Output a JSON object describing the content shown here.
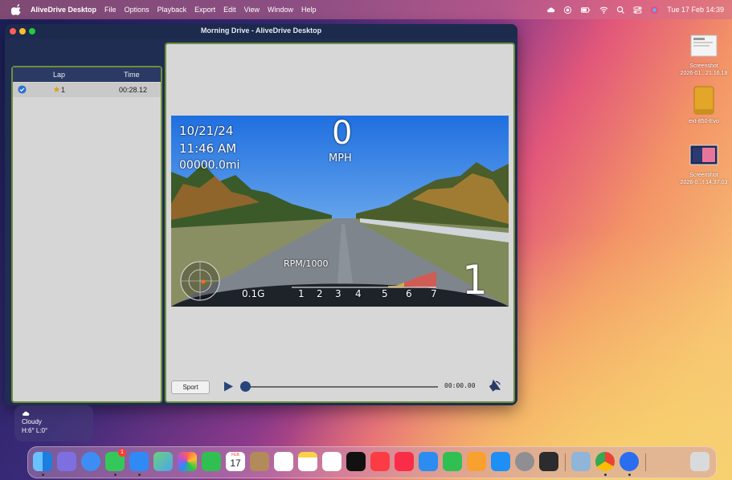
{
  "menubar": {
    "app_name": "AliveDrive Desktop",
    "menus": [
      "File",
      "Options",
      "Playback",
      "Export",
      "Edit",
      "View",
      "Window",
      "Help"
    ],
    "clock": "Tue 17 Feb  14:39"
  },
  "window": {
    "title": "Morning Drive - AliveDrive Desktop"
  },
  "laps_table": {
    "headers": {
      "lap": "Lap",
      "time": "Time"
    },
    "rows": [
      {
        "lap": "1",
        "time": "00:28.12",
        "starred": true,
        "selected": true
      }
    ]
  },
  "video_overlay": {
    "date": "10/21/24",
    "time": "11:46 AM",
    "odometer": "00000.0mi",
    "speed": "0",
    "speed_unit": "MPH",
    "gforce": "0.1G",
    "rpm_label": "RPM/1000",
    "rpm_ticks": [
      "1",
      "2",
      "3",
      "4",
      "5",
      "6",
      "7"
    ],
    "gear": "1"
  },
  "controls": {
    "mode_button": "Sport",
    "timecode": "00:00.00",
    "progress": 0
  },
  "weather": {
    "condition": "Cloudy",
    "high_low": "H:6° L:0°"
  },
  "desktop_icons": [
    {
      "label1": "Screenshot",
      "label2": "2026-01...21.16.18"
    },
    {
      "label1": "ext-850-Evo",
      "label2": ""
    },
    {
      "label1": "Screenshot",
      "label2": "2026-0...t 14.37.03"
    }
  ],
  "dock": {
    "calendar_month": "FEB",
    "calendar_day": "17",
    "badge_count": "1",
    "apps": [
      "finder",
      "launchpad",
      "safari",
      "messages",
      "mail",
      "maps",
      "photos",
      "facetime",
      "calendar",
      "contacts",
      "reminders",
      "notes",
      "freeform",
      "tv",
      "music",
      "news",
      "keynote",
      "numbers",
      "pages",
      "app-store",
      "system-settings",
      "iphone-mirroring",
      "preview",
      "chrome",
      "alivedrive",
      "trash"
    ]
  },
  "colors": {
    "window_bg": "#1f2d52",
    "panel_border": "#6f8f3a",
    "accent": "#27457a"
  }
}
